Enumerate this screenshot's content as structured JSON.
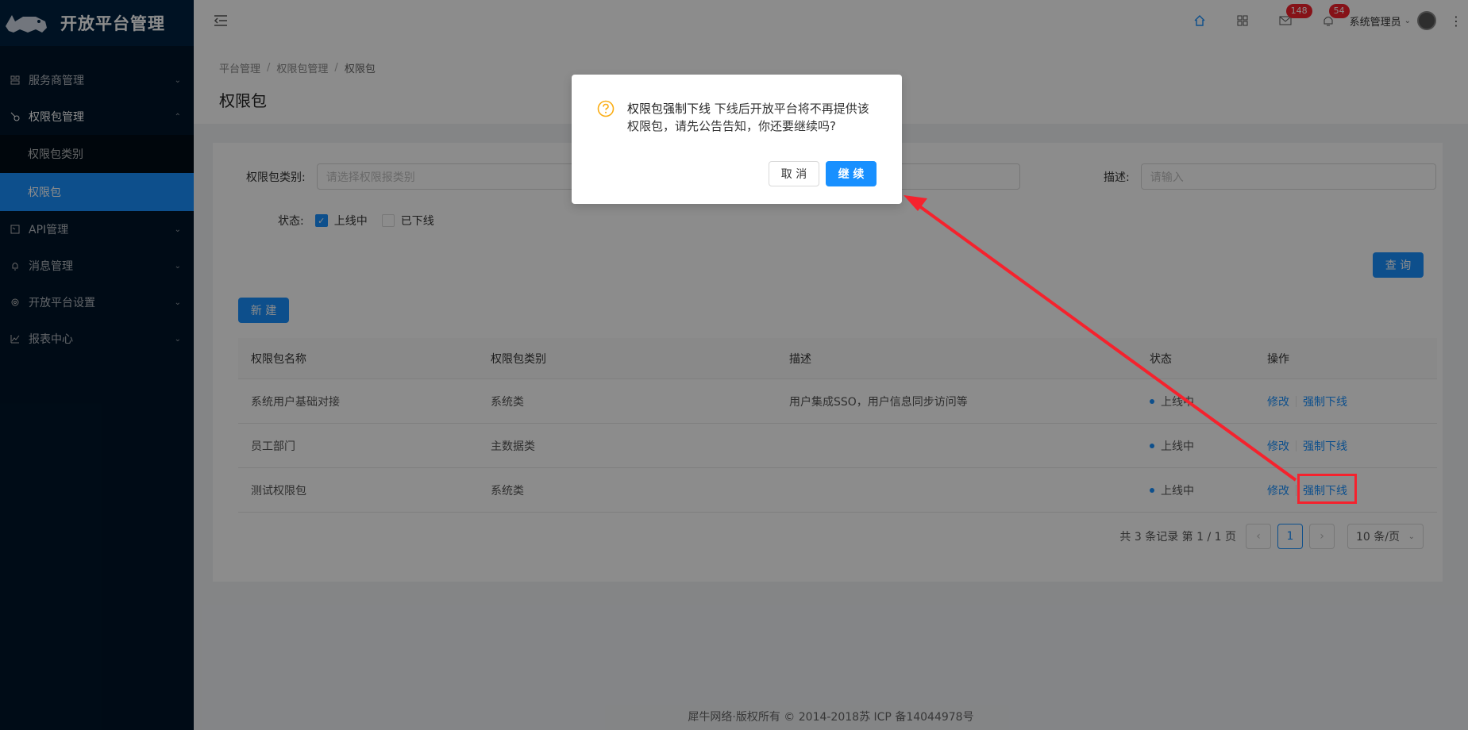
{
  "app": {
    "title": "开放平台管理"
  },
  "sidebar": {
    "items": [
      {
        "label": "服务商管理",
        "icon": "team-icon"
      },
      {
        "label": "权限包管理",
        "icon": "key-icon"
      },
      {
        "label": "API管理",
        "icon": "api-icon"
      },
      {
        "label": "消息管理",
        "icon": "bell-icon"
      },
      {
        "label": "开放平台设置",
        "icon": "gear-icon"
      },
      {
        "label": "报表中心",
        "icon": "chart-icon"
      }
    ],
    "submenu": [
      {
        "label": "权限包类别"
      },
      {
        "label": "权限包"
      }
    ]
  },
  "header": {
    "mail_badge": "148",
    "bell_badge": "54",
    "user_name": "系统管理员"
  },
  "breadcrumb": {
    "items": [
      "平台管理",
      "权限包管理",
      "权限包"
    ]
  },
  "page": {
    "title": "权限包"
  },
  "filters": {
    "category_label": "权限包类别:",
    "category_placeholder": "请选择权限报类别",
    "desc_label": "描述:",
    "desc_placeholder": "请输入",
    "status_label": "状态:",
    "status_online": "上线中",
    "status_offline": "已下线",
    "query_button": "查 询",
    "new_button": "新 建"
  },
  "table": {
    "headers": [
      "权限包名称",
      "权限包类别",
      "描述",
      "状态",
      "操作"
    ],
    "rows": [
      {
        "name": "系统用户基础对接",
        "category": "系统类",
        "desc": "用户集成SSO，用户信息同步访问等",
        "status": "上线中",
        "edit": "修改",
        "offline": "强制下线"
      },
      {
        "name": "员工部门",
        "category": "主数据类",
        "desc": "",
        "status": "上线中",
        "edit": "修改",
        "offline": "强制下线"
      },
      {
        "name": "测试权限包",
        "category": "系统类",
        "desc": "",
        "status": "上线中",
        "edit": "修改",
        "offline": "强制下线"
      }
    ]
  },
  "pagination": {
    "summary": "共 3 条记录 第 1 / 1 页",
    "current": "1",
    "page_size": "10 条/页"
  },
  "footer": {
    "text": "犀牛网络·版权所有 © 2014-2018苏 ICP 备14044978号"
  },
  "modal": {
    "title": "权限包强制下线",
    "content": "下线后开放平台将不再提供该权限包，请先公告告知，你还要继续吗?",
    "cancel": "取 消",
    "ok": "继 续"
  },
  "colors": {
    "primary": "#1890ff",
    "sidebar": "#001529",
    "warning": "#faad14",
    "annotation": "#f5222d"
  }
}
